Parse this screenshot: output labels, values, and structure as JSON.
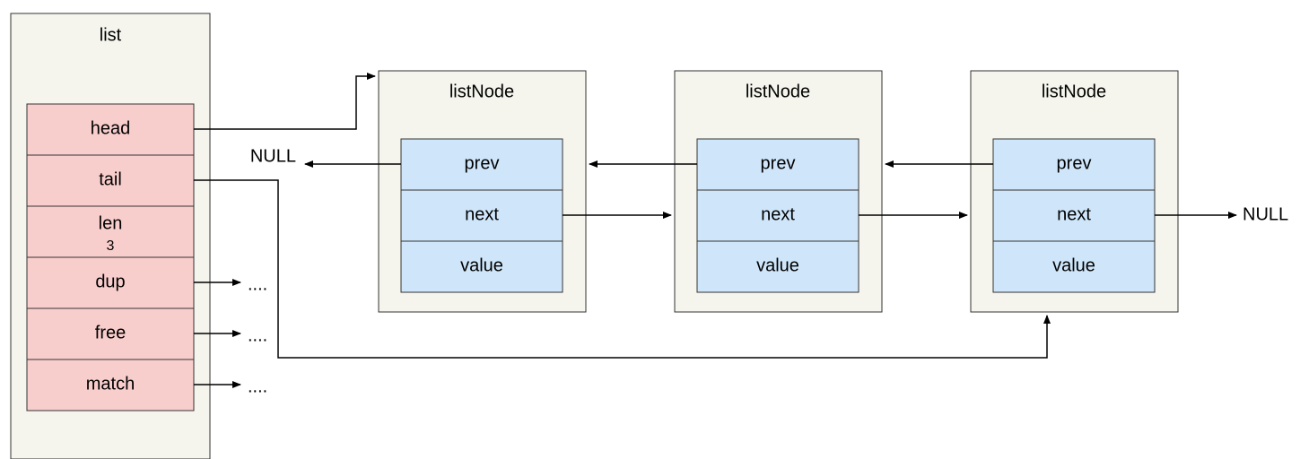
{
  "list": {
    "title": "list",
    "fields": {
      "head": "head",
      "tail": "tail",
      "len_label": "len",
      "len_value": "3",
      "dup": "dup",
      "free": "free",
      "match": "match"
    }
  },
  "nodes": [
    {
      "title": "listNode",
      "prev": "prev",
      "next": "next",
      "value": "value"
    },
    {
      "title": "listNode",
      "prev": "prev",
      "next": "next",
      "value": "value"
    },
    {
      "title": "listNode",
      "prev": "prev",
      "next": "next",
      "value": "value"
    }
  ],
  "labels": {
    "null_left": "NULL",
    "null_right": "NULL",
    "ellipsis": "...."
  }
}
